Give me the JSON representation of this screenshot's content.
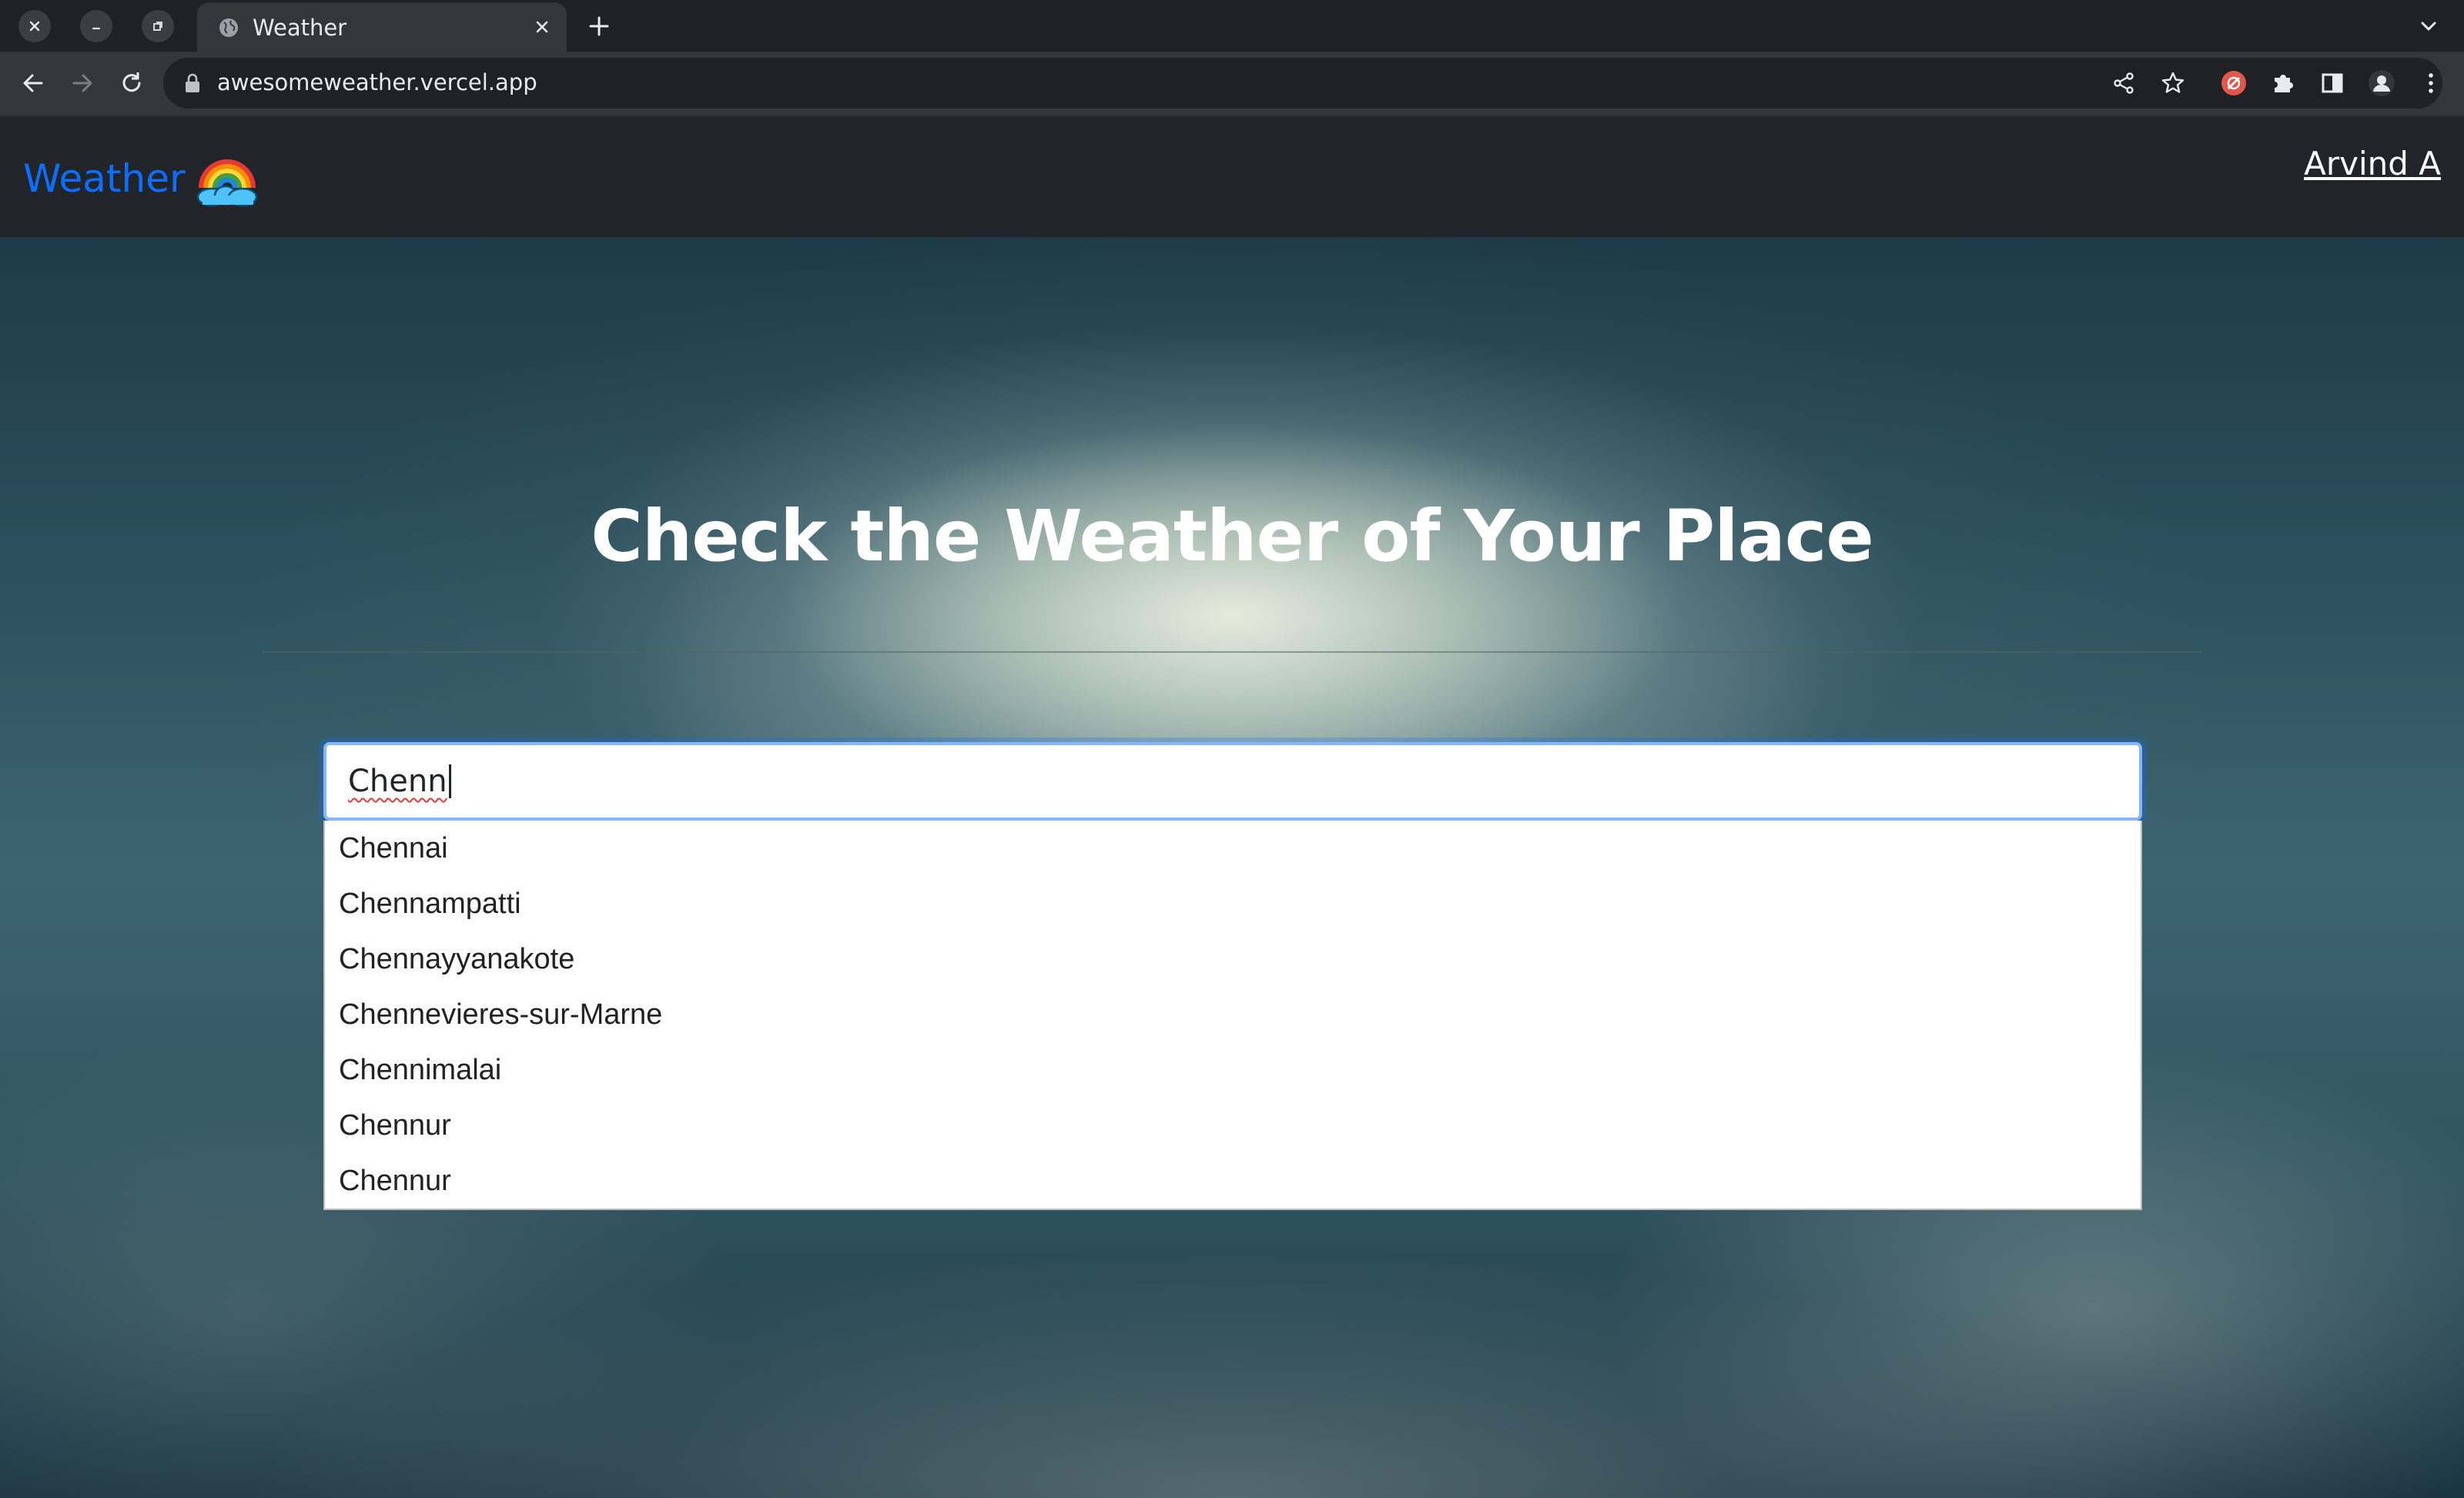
{
  "browser": {
    "tab_title": "Weather",
    "url": "awesomeweather.vercel.app",
    "icons": {
      "close_window": "close-icon",
      "minimize": "minimize-icon",
      "restore": "restore-icon",
      "favicon": "globe-icon",
      "tab_close": "close-icon",
      "new_tab": "plus-icon",
      "tab_search": "chevron-down-icon",
      "back": "arrow-left-icon",
      "forward": "arrow-right-icon",
      "reload": "reload-icon",
      "lock": "lock-icon",
      "share": "share-icon",
      "bookmark": "star-icon",
      "extension_red": "extension-badge-icon",
      "extensions": "puzzle-icon",
      "side_panel": "side-panel-icon",
      "profile": "profile-icon",
      "menu": "kebab-menu-icon"
    }
  },
  "site": {
    "brand": "Weather",
    "brand_color": "#0d6efd",
    "user_name": "Arvind A"
  },
  "hero": {
    "title": "Check the Weather of Your Place"
  },
  "search": {
    "value": "Chenn",
    "suggestions": [
      "Chennai",
      "Chennampatti",
      "Chennayyanakote",
      "Chennevieres-sur-Marne",
      "Chennimalai",
      "Chennur",
      "Chennur"
    ]
  }
}
